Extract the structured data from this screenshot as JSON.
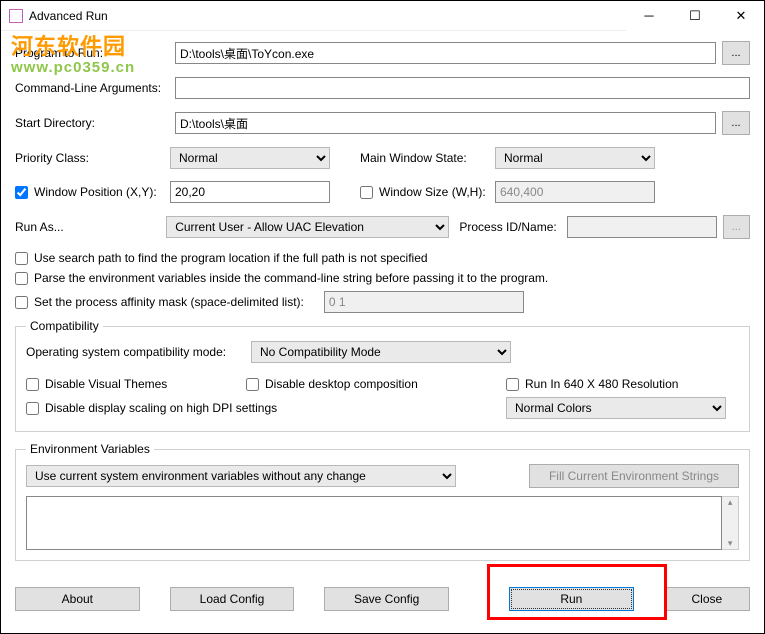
{
  "window": {
    "title": "Advanced Run"
  },
  "watermark": {
    "line1": "河东软件园",
    "line2": "www.pc0359.cn"
  },
  "labels": {
    "program": "Program to Run:",
    "cmdline": "Command-Line Arguments:",
    "startdir": "Start Directory:",
    "priority": "Priority Class:",
    "mainwin": "Main Window State:",
    "winpos": "Window Position (X,Y):",
    "winsize": "Window Size (W,H):",
    "runas": "Run As...",
    "procid": "Process ID/Name:",
    "searchpath": "Use search path to find the program location if the full path is not specified",
    "parseenv": "Parse the environment variables inside the command-line string before passing it to the program.",
    "affinity_label": "Set the process affinity mask (space-delimited list):",
    "compat_legend": "Compatibility",
    "oscompat": "Operating system compatibility mode:",
    "disable_themes": "Disable Visual Themes",
    "disable_desktop": "Disable desktop composition",
    "run640": "Run In 640 X 480 Resolution",
    "disable_dpi": "Disable display scaling on high DPI settings",
    "env_legend": "Environment Variables",
    "fill_env": "Fill Current Environment Strings"
  },
  "values": {
    "program": "D:\\tools\\桌面\\ToYcon.exe",
    "cmdline": "",
    "startdir": "D:\\tools\\桌面",
    "priority": "Normal",
    "mainwin": "Normal",
    "winpos": "20,20",
    "winsize": "640,400",
    "runas": "Current User - Allow UAC Elevation",
    "procid": "",
    "affinity": "0 1",
    "oscompat": "No Compatibility Mode",
    "colors": "Normal Colors",
    "envmode": "Use current system environment variables without any change"
  },
  "buttons": {
    "browse": "...",
    "about": "About",
    "load": "Load Config",
    "save": "Save Config",
    "run": "Run",
    "close": "Close"
  }
}
